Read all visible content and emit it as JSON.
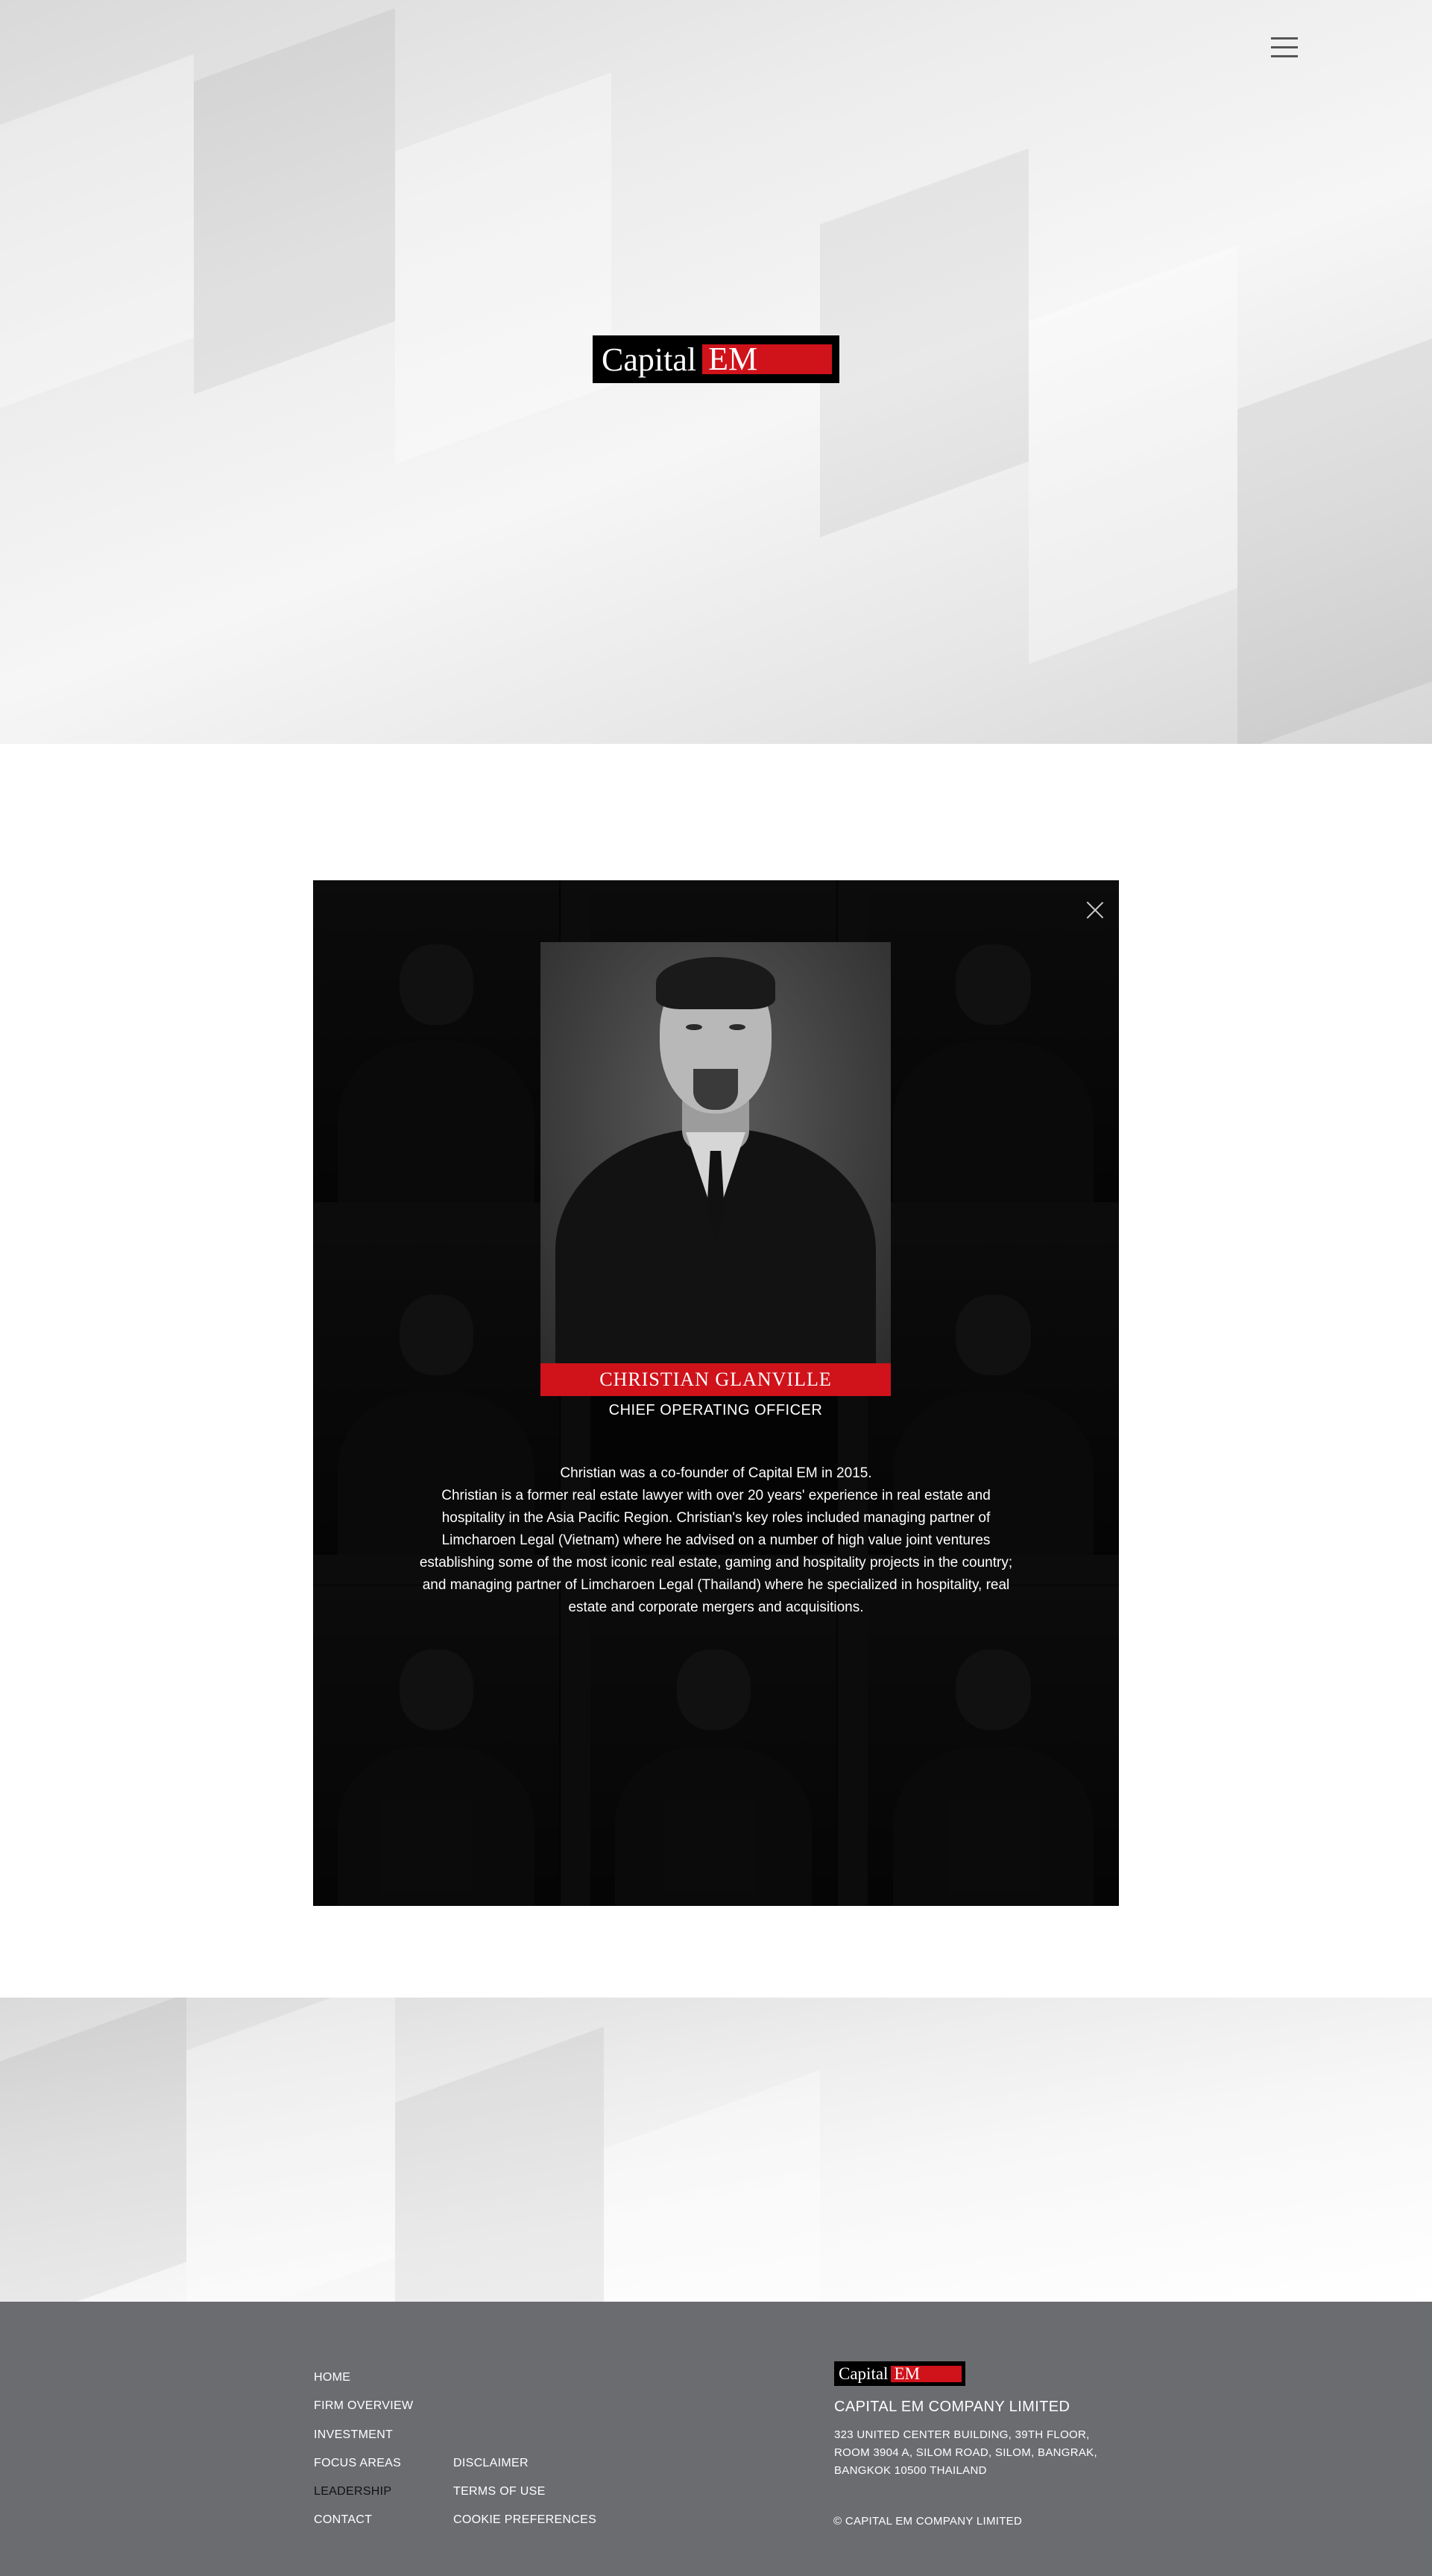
{
  "header": {
    "menu_icon": "hamburger-menu-icon"
  },
  "brand": {
    "logo_word": "Capital",
    "logo_mark": "EM",
    "accent_color": "#d0121b"
  },
  "modal": {
    "close_icon": "close-icon",
    "name": "CHRISTIAN GLANVILLE",
    "role": "CHIEF OPERATING OFFICER",
    "bio": [
      "Christian was a co-founder of Capital EM in 2015.",
      "Christian is a former real estate lawyer with over 20 years' experience in real estate and hospitality in the Asia Pacific Region. Christian's key roles included managing partner of Limcharoen Legal (Vietnam) where he advised on a number of high value joint ventures establishing some of the most iconic real estate, gaming and hospitality projects in the country; and managing partner of Limcharoen Legal (Thailand) where he specialized in hospitality, real estate and corporate mergers and acquisitions."
    ]
  },
  "footer": {
    "nav": {
      "home": "HOME",
      "firm_overview": "FIRM OVERVIEW",
      "investment": "INVESTMENT",
      "focus_areas": "FOCUS AREAS",
      "leadership": "LEADERSHIP",
      "contact": "CONTACT"
    },
    "legal": {
      "disclaimer": "DISCLAIMER",
      "terms": "TERMS OF USE",
      "cookies": "COOKIE PREFERENCES"
    },
    "company": "CAPITAL EM COMPANY LIMITED",
    "address": [
      "323 UNITED CENTER BUILDING, 39TH FLOOR,",
      "ROOM 3904 A, SILOM ROAD, SILOM, BANGRAK,",
      "BANGKOK 10500 THAILAND"
    ],
    "copyright": "© CAPITAL EM COMPANY LIMITED",
    "background_color": "#6b6c70"
  }
}
